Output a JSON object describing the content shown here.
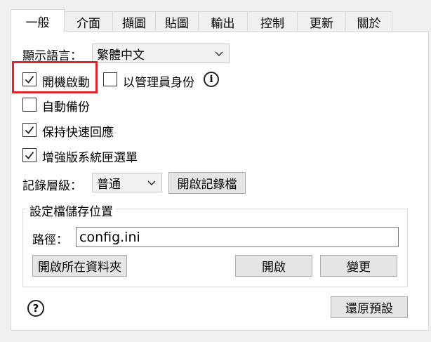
{
  "tabs": [
    {
      "label": "一般"
    },
    {
      "label": "介面"
    },
    {
      "label": "擷圖"
    },
    {
      "label": "貼圖"
    },
    {
      "label": "輸出"
    },
    {
      "label": "控制"
    },
    {
      "label": "更新"
    },
    {
      "label": "關於"
    }
  ],
  "general": {
    "language_label": "顯示語言：",
    "language_value": "繁體中文",
    "startup_label": "開機啟動",
    "startup_checked": true,
    "admin_label": "以管理員身份",
    "admin_checked": false,
    "auto_backup_label": "自動備份",
    "auto_backup_checked": false,
    "quick_reply_label": "保持快速回應",
    "quick_reply_checked": true,
    "enhanced_menu_label": "增強版系統匣選單",
    "enhanced_menu_checked": true,
    "log_level_label": "記錄層級：",
    "log_level_value": "普通",
    "open_log_button": "開啟記錄檔",
    "config_group_title": "設定檔儲存位置",
    "path_label": "路徑：",
    "path_value": "config.ini",
    "open_folder_button": "開啟所在資料夾",
    "open_button": "開啟",
    "change_button": "變更",
    "restore_defaults_button": "還原預設"
  },
  "colors": {
    "highlight": "#e0242b",
    "panel_bg": "#ffffff",
    "window_bg": "#f0f0f0"
  }
}
